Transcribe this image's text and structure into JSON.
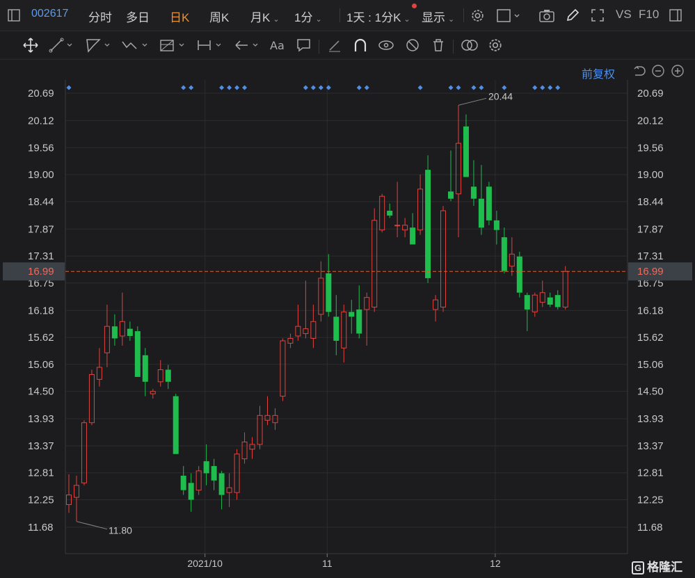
{
  "header": {
    "stock_code": "002617",
    "tabs": [
      {
        "label": "分时",
        "active": false
      },
      {
        "label": "多日",
        "active": false
      },
      {
        "label": "日K",
        "active": true
      },
      {
        "label": "周K",
        "active": false
      },
      {
        "label": "月K",
        "active": false
      }
    ],
    "interval": "1分",
    "range": "1天 : 1分K",
    "display_label": "显示",
    "vs_label": "VS",
    "f10_label": "F10"
  },
  "toolbar_icons": [
    "move-icon",
    "line-icon",
    "polygon-icon",
    "wave-icon",
    "fib-icon",
    "range-icon",
    "arrow-icon",
    "text-icon",
    "note-icon",
    "pen-icon",
    "magnet-icon",
    "eye-icon",
    "hide-icon",
    "trash-icon",
    "layers-icon",
    "settings-icon"
  ],
  "adjust_label": "前复权",
  "brand_label": "格隆汇",
  "colors": {
    "up": "#e0433f",
    "down": "#1fbd4d",
    "grid": "#2c2c2e",
    "price_line": "#e06030",
    "marker": "#4f8fe6"
  },
  "chart_data": {
    "type": "candlestick",
    "y_ticks": [
      "20.69",
      "20.12",
      "19.56",
      "19.00",
      "18.44",
      "17.87",
      "17.31",
      "16.75",
      "16.18",
      "15.62",
      "15.06",
      "14.50",
      "13.93",
      "13.37",
      "12.81",
      "12.25",
      "11.68"
    ],
    "ylim": [
      11.68,
      20.69
    ],
    "x_labels": [
      {
        "label": "2021/10",
        "index": 18
      },
      {
        "label": "11",
        "index": 34
      },
      {
        "label": "12",
        "index": 56
      }
    ],
    "current_price": "16.99",
    "max_label": "20.44",
    "max_index": 51,
    "min_label": "11.80",
    "min_index": 1,
    "markers": [
      0,
      15,
      16,
      20,
      21,
      22,
      23,
      31,
      32,
      33,
      34,
      38,
      39,
      46,
      50,
      51,
      53,
      54,
      57,
      61,
      62,
      63,
      64
    ],
    "candles": [
      {
        "o": 12.15,
        "h": 12.78,
        "l": 11.98,
        "c": 12.35
      },
      {
        "o": 12.3,
        "h": 12.75,
        "l": 11.8,
        "c": 12.55
      },
      {
        "o": 12.6,
        "h": 13.9,
        "l": 12.55,
        "c": 13.85
      },
      {
        "o": 13.85,
        "h": 14.95,
        "l": 13.8,
        "c": 14.85
      },
      {
        "o": 14.75,
        "h": 15.4,
        "l": 14.6,
        "c": 15.0
      },
      {
        "o": 15.3,
        "h": 16.3,
        "l": 15.0,
        "c": 15.85
      },
      {
        "o": 15.85,
        "h": 16.1,
        "l": 15.45,
        "c": 15.6
      },
      {
        "o": 15.65,
        "h": 16.55,
        "l": 15.45,
        "c": 15.95
      },
      {
        "o": 15.8,
        "h": 15.95,
        "l": 15.55,
        "c": 15.65
      },
      {
        "o": 15.75,
        "h": 15.85,
        "l": 14.8,
        "c": 14.8
      },
      {
        "o": 15.25,
        "h": 15.4,
        "l": 14.4,
        "c": 14.7
      },
      {
        "o": 14.45,
        "h": 14.55,
        "l": 14.35,
        "c": 14.5
      },
      {
        "o": 14.7,
        "h": 15.15,
        "l": 14.6,
        "c": 14.95
      },
      {
        "o": 14.95,
        "h": 15.05,
        "l": 14.55,
        "c": 14.7
      },
      {
        "o": 14.4,
        "h": 14.45,
        "l": 13.2,
        "c": 13.2
      },
      {
        "o": 12.75,
        "h": 12.95,
        "l": 12.35,
        "c": 12.45
      },
      {
        "o": 12.6,
        "h": 12.8,
        "l": 12.0,
        "c": 12.25
      },
      {
        "o": 12.45,
        "h": 12.95,
        "l": 12.35,
        "c": 12.85
      },
      {
        "o": 13.05,
        "h": 13.4,
        "l": 12.55,
        "c": 12.8
      },
      {
        "o": 12.95,
        "h": 13.1,
        "l": 12.45,
        "c": 12.65
      },
      {
        "o": 12.8,
        "h": 12.85,
        "l": 12.05,
        "c": 12.35
      },
      {
        "o": 12.4,
        "h": 12.8,
        "l": 12.1,
        "c": 12.5
      },
      {
        "o": 12.4,
        "h": 13.3,
        "l": 12.25,
        "c": 13.2
      },
      {
        "o": 13.1,
        "h": 13.65,
        "l": 13.0,
        "c": 13.45
      },
      {
        "o": 13.3,
        "h": 13.55,
        "l": 13.1,
        "c": 13.4
      },
      {
        "o": 13.4,
        "h": 14.2,
        "l": 13.3,
        "c": 14.0
      },
      {
        "o": 13.9,
        "h": 14.4,
        "l": 13.8,
        "c": 14.0
      },
      {
        "o": 13.85,
        "h": 14.15,
        "l": 13.7,
        "c": 14.0
      },
      {
        "o": 14.4,
        "h": 15.6,
        "l": 14.3,
        "c": 15.55
      },
      {
        "o": 15.5,
        "h": 15.7,
        "l": 15.4,
        "c": 15.6
      },
      {
        "o": 15.65,
        "h": 16.3,
        "l": 15.55,
        "c": 15.85
      },
      {
        "o": 15.7,
        "h": 16.8,
        "l": 15.6,
        "c": 15.8
      },
      {
        "o": 15.6,
        "h": 16.3,
        "l": 15.4,
        "c": 15.95
      },
      {
        "o": 16.1,
        "h": 17.2,
        "l": 15.95,
        "c": 16.85
      },
      {
        "o": 16.95,
        "h": 17.35,
        "l": 16.05,
        "c": 16.15
      },
      {
        "o": 16.05,
        "h": 16.5,
        "l": 15.25,
        "c": 15.55
      },
      {
        "o": 15.4,
        "h": 16.3,
        "l": 15.1,
        "c": 16.15
      },
      {
        "o": 16.15,
        "h": 16.4,
        "l": 15.7,
        "c": 16.05
      },
      {
        "o": 16.2,
        "h": 16.7,
        "l": 15.6,
        "c": 15.7
      },
      {
        "o": 16.2,
        "h": 16.55,
        "l": 15.45,
        "c": 16.45
      },
      {
        "o": 16.25,
        "h": 18.3,
        "l": 16.15,
        "c": 18.05
      },
      {
        "o": 17.85,
        "h": 18.6,
        "l": 17.8,
        "c": 18.55
      },
      {
        "o": 18.25,
        "h": 18.4,
        "l": 18.1,
        "c": 18.15
      },
      {
        "o": 17.95,
        "h": 18.85,
        "l": 17.7,
        "c": 17.95
      },
      {
        "o": 17.85,
        "h": 18.1,
        "l": 17.7,
        "c": 17.95
      },
      {
        "o": 17.9,
        "h": 18.2,
        "l": 17.55,
        "c": 17.55
      },
      {
        "o": 17.85,
        "h": 19.0,
        "l": 17.75,
        "c": 18.7
      },
      {
        "o": 19.1,
        "h": 19.4,
        "l": 16.75,
        "c": 16.85
      },
      {
        "o": 16.2,
        "h": 16.5,
        "l": 15.95,
        "c": 16.4
      },
      {
        "o": 16.25,
        "h": 18.35,
        "l": 16.15,
        "c": 18.25
      },
      {
        "o": 18.65,
        "h": 19.5,
        "l": 18.45,
        "c": 18.5
      },
      {
        "o": 18.6,
        "h": 20.44,
        "l": 17.7,
        "c": 19.65
      },
      {
        "o": 20.0,
        "h": 20.25,
        "l": 18.95,
        "c": 18.95
      },
      {
        "o": 18.75,
        "h": 19.3,
        "l": 18.35,
        "c": 18.5
      },
      {
        "o": 18.5,
        "h": 19.2,
        "l": 17.75,
        "c": 17.9
      },
      {
        "o": 18.75,
        "h": 18.85,
        "l": 17.95,
        "c": 18.05
      },
      {
        "o": 18.05,
        "h": 18.25,
        "l": 17.55,
        "c": 17.85
      },
      {
        "o": 17.7,
        "h": 17.9,
        "l": 16.95,
        "c": 17.0
      },
      {
        "o": 17.1,
        "h": 17.7,
        "l": 16.9,
        "c": 17.35
      },
      {
        "o": 17.3,
        "h": 17.4,
        "l": 16.45,
        "c": 16.55
      },
      {
        "o": 16.5,
        "h": 16.55,
        "l": 15.75,
        "c": 16.2
      },
      {
        "o": 16.15,
        "h": 16.55,
        "l": 16.05,
        "c": 16.5
      },
      {
        "o": 16.35,
        "h": 16.8,
        "l": 16.25,
        "c": 16.55
      },
      {
        "o": 16.45,
        "h": 16.55,
        "l": 16.25,
        "c": 16.3
      },
      {
        "o": 16.5,
        "h": 16.6,
        "l": 16.2,
        "c": 16.25
      },
      {
        "o": 16.25,
        "h": 17.1,
        "l": 16.2,
        "c": 16.99
      }
    ]
  }
}
